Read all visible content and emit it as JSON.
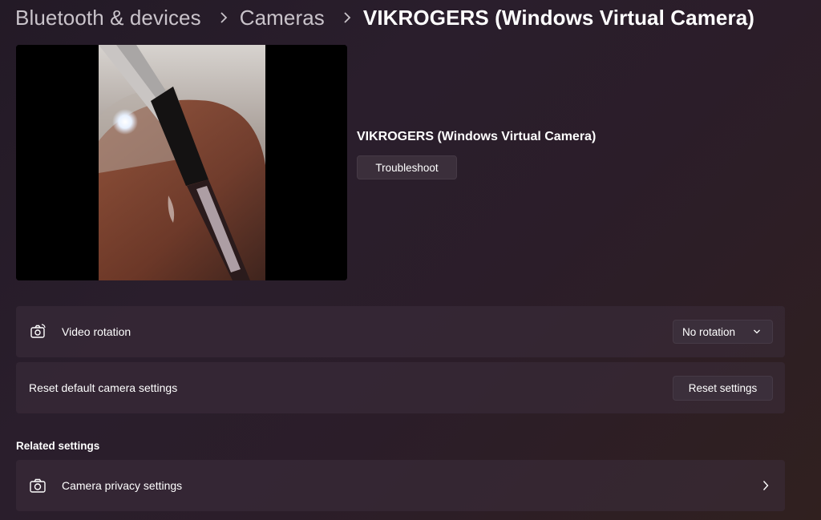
{
  "breadcrumb": {
    "items": [
      {
        "label": "Bluetooth & devices"
      },
      {
        "label": "Cameras"
      }
    ],
    "current": "VIKROGERS (Windows Virtual Camera)"
  },
  "camera": {
    "name": "VIKROGERS (Windows Virtual Camera)",
    "troubleshoot_label": "Troubleshoot"
  },
  "settings": {
    "video_rotation": {
      "label": "Video rotation",
      "value": "No rotation",
      "icon": "camera-rotate-icon"
    },
    "reset": {
      "label": "Reset default camera settings",
      "button_label": "Reset settings"
    }
  },
  "related": {
    "title": "Related settings",
    "items": [
      {
        "label": "Camera privacy settings",
        "icon": "camera-icon"
      }
    ]
  },
  "colors": {
    "accent_text": "#ffffff",
    "muted_text": "#c9c3ca",
    "card_bg": "#3c2e3c",
    "button_bg": "#3b2f3b"
  }
}
